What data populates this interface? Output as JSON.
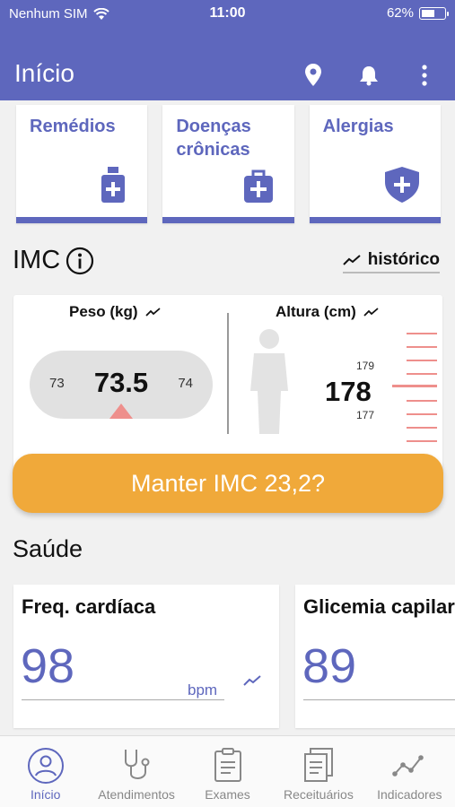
{
  "status": {
    "carrier": "Nenhum SIM",
    "time": "11:00",
    "battery": "62%",
    "battery_level": 0.62
  },
  "header": {
    "title": "Início"
  },
  "categories": [
    {
      "label": "Remédios",
      "icon": "medicine-bottle-icon"
    },
    {
      "label": "Doenças crônicas",
      "icon": "medical-kit-icon"
    },
    {
      "label": "Alergias",
      "icon": "shield-plus-icon"
    }
  ],
  "imc": {
    "title": "IMC",
    "history_label": "histórico",
    "peso": {
      "label": "Peso (kg)",
      "low": "73",
      "value": "73.5",
      "high": "74"
    },
    "altura": {
      "label": "Altura (cm)",
      "high": "179",
      "value": "178",
      "low": "177"
    },
    "button_label": "Manter IMC 23,2?"
  },
  "saude": {
    "title": "Saúde",
    "cards": [
      {
        "title": "Freq. cardíaca",
        "value": "98",
        "unit": "bpm"
      },
      {
        "title": "Glicemia capilar",
        "value": "89"
      }
    ]
  },
  "tabs": [
    {
      "label": "Início",
      "icon": "home-user-icon",
      "active": true
    },
    {
      "label": "Atendimentos",
      "icon": "stethoscope-icon"
    },
    {
      "label": "Exames",
      "icon": "clipboard-icon"
    },
    {
      "label": "Receituários",
      "icon": "documents-icon"
    },
    {
      "label": "Indicadores",
      "icon": "line-chart-icon"
    }
  ],
  "colors": {
    "primary": "#5e67bd",
    "accent": "#f0a93a",
    "marker": "#ee8f8c"
  }
}
